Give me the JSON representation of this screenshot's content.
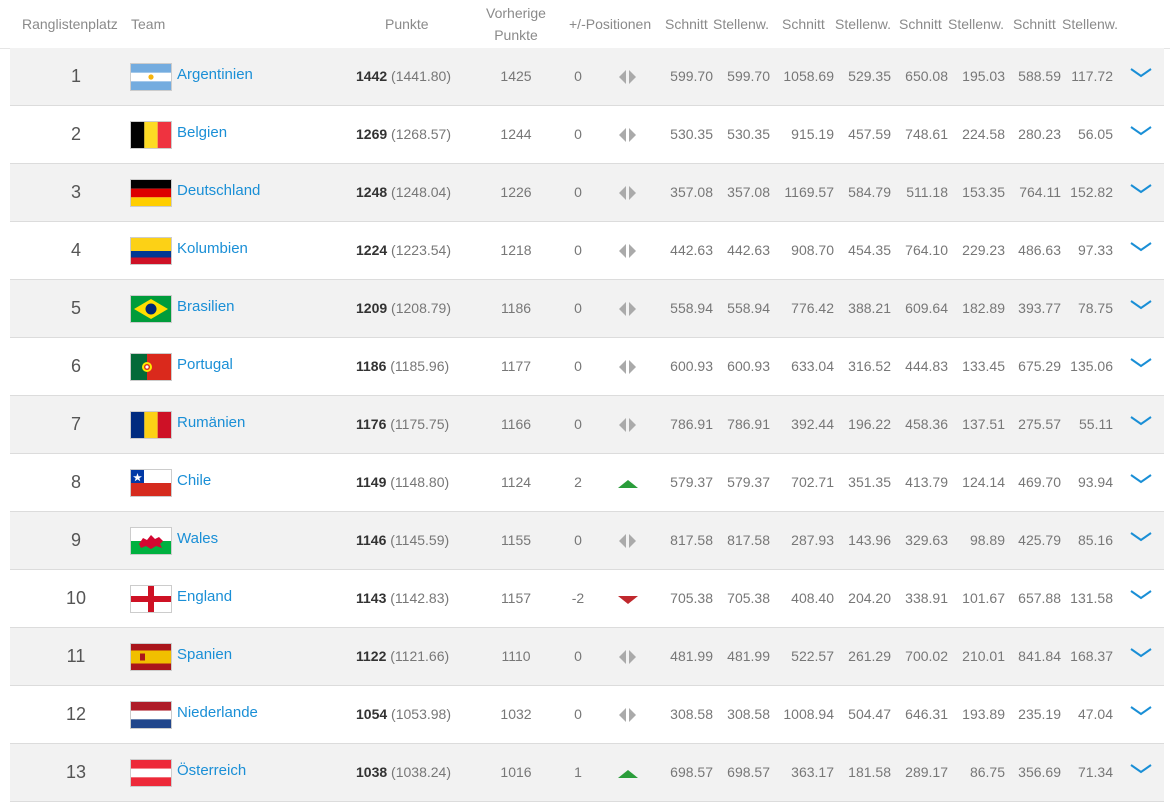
{
  "header": {
    "rank": "Ranglistenplatz",
    "team": "Team",
    "points": "Punkte",
    "prev_points_line1": "Vorherige",
    "prev_points_line2": "Punkte",
    "positions": "+/-Positionen",
    "avg1": "Schnitt",
    "weight1": "Stellenw.",
    "avg2": "Schnitt",
    "weight2": "Stellenw.",
    "avg3": "Schnitt",
    "weight3": "Stellenw.",
    "avg4": "Schnitt",
    "weight4": "Stellenw."
  },
  "colors": {
    "link": "#1a8fd6",
    "trend_up": "#2a9d3a",
    "trend_down": "#c0282d",
    "trend_neutral": "#aaaaaa",
    "row_alt": "#f2f2f2"
  },
  "rows": [
    {
      "rank": "1",
      "team": "Argentinien",
      "flag": "argentina",
      "points": "1442",
      "points_exact": "(1441.80)",
      "prev": "1425",
      "diff": "0",
      "trend": "neutral",
      "vals": [
        "599.70",
        "599.70",
        "1058.69",
        "529.35",
        "650.08",
        "195.03",
        "588.59",
        "117.72"
      ]
    },
    {
      "rank": "2",
      "team": "Belgien",
      "flag": "belgium",
      "points": "1269",
      "points_exact": "(1268.57)",
      "prev": "1244",
      "diff": "0",
      "trend": "neutral",
      "vals": [
        "530.35",
        "530.35",
        "915.19",
        "457.59",
        "748.61",
        "224.58",
        "280.23",
        "56.05"
      ]
    },
    {
      "rank": "3",
      "team": "Deutschland",
      "flag": "germany",
      "points": "1248",
      "points_exact": "(1248.04)",
      "prev": "1226",
      "diff": "0",
      "trend": "neutral",
      "vals": [
        "357.08",
        "357.08",
        "1169.57",
        "584.79",
        "511.18",
        "153.35",
        "764.11",
        "152.82"
      ]
    },
    {
      "rank": "4",
      "team": "Kolumbien",
      "flag": "colombia",
      "points": "1224",
      "points_exact": "(1223.54)",
      "prev": "1218",
      "diff": "0",
      "trend": "neutral",
      "vals": [
        "442.63",
        "442.63",
        "908.70",
        "454.35",
        "764.10",
        "229.23",
        "486.63",
        "97.33"
      ]
    },
    {
      "rank": "5",
      "team": "Brasilien",
      "flag": "brazil",
      "points": "1209",
      "points_exact": "(1208.79)",
      "prev": "1186",
      "diff": "0",
      "trend": "neutral",
      "vals": [
        "558.94",
        "558.94",
        "776.42",
        "388.21",
        "609.64",
        "182.89",
        "393.77",
        "78.75"
      ]
    },
    {
      "rank": "6",
      "team": "Portugal",
      "flag": "portugal",
      "points": "1186",
      "points_exact": "(1185.96)",
      "prev": "1177",
      "diff": "0",
      "trend": "neutral",
      "vals": [
        "600.93",
        "600.93",
        "633.04",
        "316.52",
        "444.83",
        "133.45",
        "675.29",
        "135.06"
      ]
    },
    {
      "rank": "7",
      "team": "Rumänien",
      "flag": "romania",
      "points": "1176",
      "points_exact": "(1175.75)",
      "prev": "1166",
      "diff": "0",
      "trend": "neutral",
      "vals": [
        "786.91",
        "786.91",
        "392.44",
        "196.22",
        "458.36",
        "137.51",
        "275.57",
        "55.11"
      ]
    },
    {
      "rank": "8",
      "team": "Chile",
      "flag": "chile",
      "points": "1149",
      "points_exact": "(1148.80)",
      "prev": "1124",
      "diff": "2",
      "trend": "up",
      "vals": [
        "579.37",
        "579.37",
        "702.71",
        "351.35",
        "413.79",
        "124.14",
        "469.70",
        "93.94"
      ]
    },
    {
      "rank": "9",
      "team": "Wales",
      "flag": "wales",
      "points": "1146",
      "points_exact": "(1145.59)",
      "prev": "1155",
      "diff": "0",
      "trend": "neutral",
      "vals": [
        "817.58",
        "817.58",
        "287.93",
        "143.96",
        "329.63",
        "98.89",
        "425.79",
        "85.16"
      ]
    },
    {
      "rank": "10",
      "team": "England",
      "flag": "england",
      "points": "1143",
      "points_exact": "(1142.83)",
      "prev": "1157",
      "diff": "-2",
      "trend": "down",
      "vals": [
        "705.38",
        "705.38",
        "408.40",
        "204.20",
        "338.91",
        "101.67",
        "657.88",
        "131.58"
      ]
    },
    {
      "rank": "11",
      "team": "Spanien",
      "flag": "spain",
      "points": "1122",
      "points_exact": "(1121.66)",
      "prev": "1110",
      "diff": "0",
      "trend": "neutral",
      "vals": [
        "481.99",
        "481.99",
        "522.57",
        "261.29",
        "700.02",
        "210.01",
        "841.84",
        "168.37"
      ]
    },
    {
      "rank": "12",
      "team": "Niederlande",
      "flag": "netherlands",
      "points": "1054",
      "points_exact": "(1053.98)",
      "prev": "1032",
      "diff": "0",
      "trend": "neutral",
      "vals": [
        "308.58",
        "308.58",
        "1008.94",
        "504.47",
        "646.31",
        "193.89",
        "235.19",
        "47.04"
      ]
    },
    {
      "rank": "13",
      "team": "Österreich",
      "flag": "austria",
      "points": "1038",
      "points_exact": "(1038.24)",
      "prev": "1016",
      "diff": "1",
      "trend": "up",
      "vals": [
        "698.57",
        "698.57",
        "363.17",
        "181.58",
        "289.17",
        "86.75",
        "356.69",
        "71.34"
      ]
    }
  ]
}
